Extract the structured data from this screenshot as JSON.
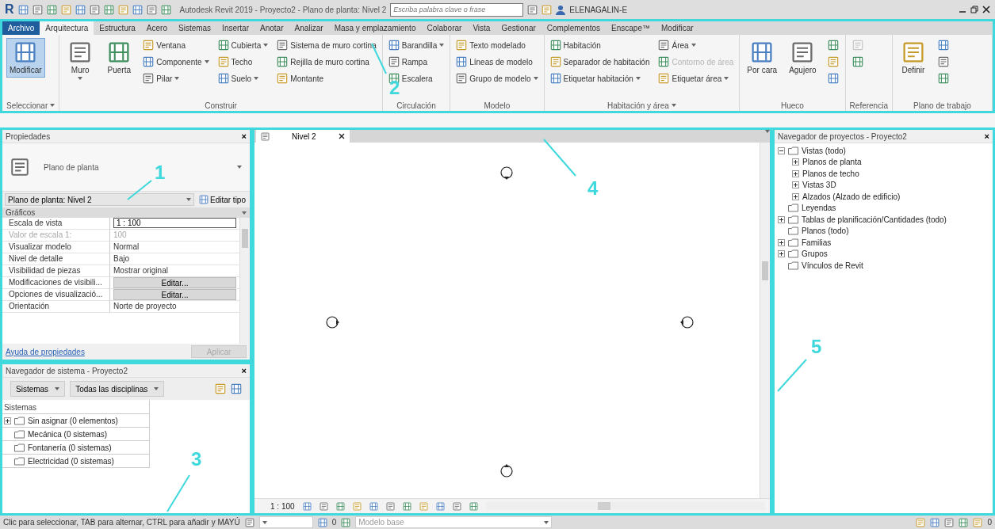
{
  "title_bar": {
    "logo": "R",
    "title": "Autodesk Revit 2019 - Proyecto2 - Plano de planta: Nivel 2",
    "search": {
      "placeholder": "Escriba palabra clave o frase"
    },
    "user": "ELENAGALIN-E"
  },
  "ribbon": {
    "annotation": "2",
    "tabs": [
      {
        "label": "Archivo",
        "kind": "file",
        "selected": false
      },
      {
        "label": "Arquitectura",
        "kind": "tab",
        "selected": true
      },
      {
        "label": "Estructura",
        "kind": "tab",
        "selected": false
      },
      {
        "label": "Acero",
        "kind": "tab",
        "selected": false
      },
      {
        "label": "Sistemas",
        "kind": "tab",
        "selected": false
      },
      {
        "label": "Insertar",
        "kind": "tab",
        "selected": false
      },
      {
        "label": "Anotar",
        "kind": "tab",
        "selected": false
      },
      {
        "label": "Analizar",
        "kind": "tab",
        "selected": false
      },
      {
        "label": "Masa y emplazamiento",
        "kind": "tab",
        "selected": false
      },
      {
        "label": "Colaborar",
        "kind": "tab",
        "selected": false
      },
      {
        "label": "Vista",
        "kind": "tab",
        "selected": false
      },
      {
        "label": "Gestionar",
        "kind": "tab",
        "selected": false
      },
      {
        "label": "Complementos",
        "kind": "tab",
        "selected": false
      },
      {
        "label": "Enscape™",
        "kind": "tab",
        "selected": false
      },
      {
        "label": "Modificar",
        "kind": "tab",
        "selected": false
      }
    ],
    "panels": [
      {
        "title": "Seleccionar",
        "dropdown": true,
        "columns": [
          [
            {
              "label": "Modificar",
              "kind": "large",
              "active": true
            }
          ]
        ]
      },
      {
        "title": "Construir",
        "dropdown": false,
        "columns": [
          [
            {
              "label": "Muro",
              "kind": "large",
              "dropdown": true
            }
          ],
          [
            {
              "label": "Puerta",
              "kind": "large"
            }
          ],
          [
            {
              "label": "Ventana",
              "kind": "small"
            },
            {
              "label": "Componente",
              "kind": "small",
              "dropdown": true
            },
            {
              "label": "Pilar",
              "kind": "small",
              "dropdown": true
            }
          ],
          [
            {
              "label": "Cubierta",
              "kind": "small",
              "dropdown": true
            },
            {
              "label": "Techo",
              "kind": "small"
            },
            {
              "label": "Suelo",
              "kind": "small",
              "dropdown": true
            }
          ],
          [
            {
              "label": "Sistema de muro cortina",
              "kind": "small"
            },
            {
              "label": "Rejilla de muro cortina",
              "kind": "small"
            },
            {
              "label": "Montante",
              "kind": "small"
            }
          ]
        ]
      },
      {
        "title": "Circulación",
        "dropdown": false,
        "columns": [
          [
            {
              "label": "Barandilla",
              "kind": "small",
              "dropdown": true
            },
            {
              "label": "Rampa",
              "kind": "small"
            },
            {
              "label": "Escalera",
              "kind": "small"
            }
          ]
        ]
      },
      {
        "title": "Modelo",
        "dropdown": false,
        "columns": [
          [
            {
              "label": "Texto modelado",
              "kind": "small"
            },
            {
              "label": "Líneas de modelo",
              "kind": "small"
            },
            {
              "label": "Grupo de modelo",
              "kind": "small",
              "dropdown": true
            }
          ]
        ]
      },
      {
        "title": "Habitación y área",
        "dropdown": true,
        "columns": [
          [
            {
              "label": "Habitación",
              "kind": "small"
            },
            {
              "label": "Separador de habitación",
              "kind": "small"
            },
            {
              "label": "Etiquetar habitación",
              "kind": "small",
              "dropdown": true
            }
          ],
          [
            {
              "label": "Área",
              "kind": "small",
              "dropdown": true
            },
            {
              "label": "Contorno de área",
              "kind": "small",
              "disabled": true
            },
            {
              "label": "Etiquetar área",
              "kind": "small",
              "dropdown": true
            }
          ]
        ]
      },
      {
        "title": "Hueco",
        "dropdown": false,
        "columns": [
          [
            {
              "label": "Por cara",
              "kind": "large"
            }
          ],
          [
            {
              "label": "Agujero",
              "kind": "large"
            }
          ],
          [
            {
              "kind": "icon"
            },
            {
              "kind": "icon"
            },
            {
              "kind": "icon"
            }
          ]
        ]
      },
      {
        "title": "Referencia",
        "dropdown": false,
        "columns": [
          [
            {
              "kind": "icon",
              "disabled": true
            },
            {
              "kind": "icon"
            }
          ]
        ]
      },
      {
        "title": "Plano de trabajo",
        "dropdown": false,
        "columns": [
          [
            {
              "label": "Definir",
              "kind": "large"
            }
          ],
          [
            {
              "kind": "icon"
            },
            {
              "kind": "icon"
            },
            {
              "kind": "icon"
            }
          ]
        ]
      }
    ]
  },
  "properties": {
    "annotation": "1",
    "title": "Propiedades",
    "close": "×",
    "type_name": "Plano de planta",
    "instance": "Plano de planta: Nivel 2",
    "edit_type": "Editar tipo",
    "section": "Gráficos",
    "rows": [
      {
        "name": "Escala de vista",
        "value": "1 : 100",
        "kind": "input"
      },
      {
        "name": "Valor de escala    1:",
        "value": "100",
        "kind": "disabled"
      },
      {
        "name": "Visualizar modelo",
        "value": "Normal",
        "kind": "text"
      },
      {
        "name": "Nivel de detalle",
        "value": "Bajo",
        "kind": "text"
      },
      {
        "name": "Visibilidad de piezas",
        "value": "Mostrar original",
        "kind": "text"
      },
      {
        "name": "Modificaciones de visibili...",
        "value": "Editar...",
        "kind": "button"
      },
      {
        "name": "Opciones de visualizació...",
        "value": "Editar...",
        "kind": "button"
      },
      {
        "name": "Orientación",
        "value": "Norte de proyecto",
        "kind": "text"
      }
    ],
    "help_link": "Ayuda de propiedades",
    "apply": {
      "label": "Aplicar",
      "disabled": true
    }
  },
  "system_browser": {
    "annotation": "3",
    "title": "Navegador de sistema - Proyecto2",
    "close": "×",
    "filters": [
      "Sistemas",
      "Todas las disciplinas"
    ],
    "tree_header": "Sistemas",
    "items": [
      {
        "label": "Sin asignar (0 elementos)",
        "expanded": false
      },
      {
        "label": "Mecánica (0 sistemas)"
      },
      {
        "label": "Fontanería (0 sistemas)"
      },
      {
        "label": "Electricidad (0 sistemas)"
      }
    ]
  },
  "view": {
    "annotation": "4",
    "tab": {
      "label": "Nivel 2",
      "selected": true
    },
    "scale": "1 : 100"
  },
  "project_browser": {
    "annotation": "5",
    "title": "Navegador de proyectos - Proyecto2",
    "close": "×",
    "tree": [
      {
        "label": "Vistas (todo)",
        "expanded": true,
        "children": [
          {
            "label": "Planos de planta",
            "expanded": false
          },
          {
            "label": "Planos de techo",
            "expanded": false
          },
          {
            "label": "Vistas 3D",
            "expanded": false
          },
          {
            "label": "Alzados (Alzado de edificio)",
            "expanded": false
          }
        ]
      },
      {
        "label": "Leyendas"
      },
      {
        "label": "Tablas de planificación/Cantidades (todo)",
        "expanded": false
      },
      {
        "label": "Planos (todo)"
      },
      {
        "label": "Familias",
        "expanded": false
      },
      {
        "label": "Grupos",
        "expanded": false
      },
      {
        "label": "Vínculos de Revit"
      }
    ]
  },
  "status_bar": {
    "message": "Clic para seleccionar, TAB para alternar, CTRL para añadir y MAYÚ",
    "workset": "0",
    "model": "Modelo base",
    "filter_count": "0"
  }
}
